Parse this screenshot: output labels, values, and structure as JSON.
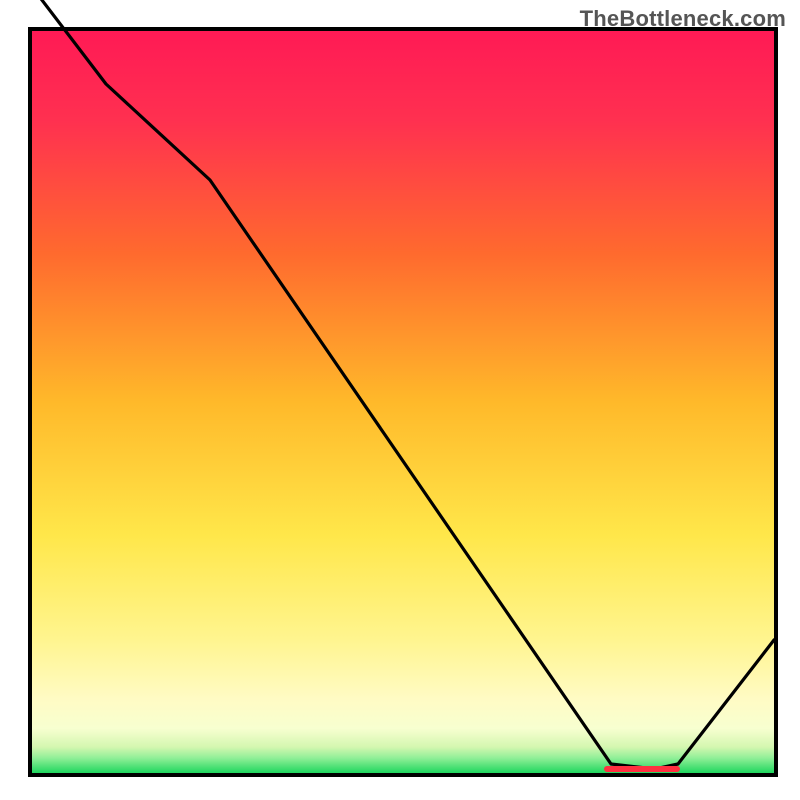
{
  "attribution": "TheBottleneck.com",
  "chart_data": {
    "type": "line",
    "x": [
      0.0,
      0.1,
      0.24,
      0.78,
      0.84,
      0.87,
      1.0
    ],
    "values": [
      1.06,
      0.93,
      0.8,
      0.012,
      0.006,
      0.012,
      0.18
    ],
    "title": "",
    "xlabel": "",
    "ylabel": "",
    "xlim": [
      0,
      1
    ],
    "ylim": [
      0,
      1
    ],
    "minimum_band": {
      "x_start": 0.77,
      "x_end": 0.87,
      "y": 0.006
    },
    "background_gradient": {
      "top": "#ff1a55",
      "mid_upper": "#ff6a2e",
      "mid": "#ffb92a",
      "lower_mid": "#ffe74a",
      "low": "#fff58f",
      "thin_pale": "#f7ffd0",
      "bottom_green": "#1fd65e"
    }
  }
}
